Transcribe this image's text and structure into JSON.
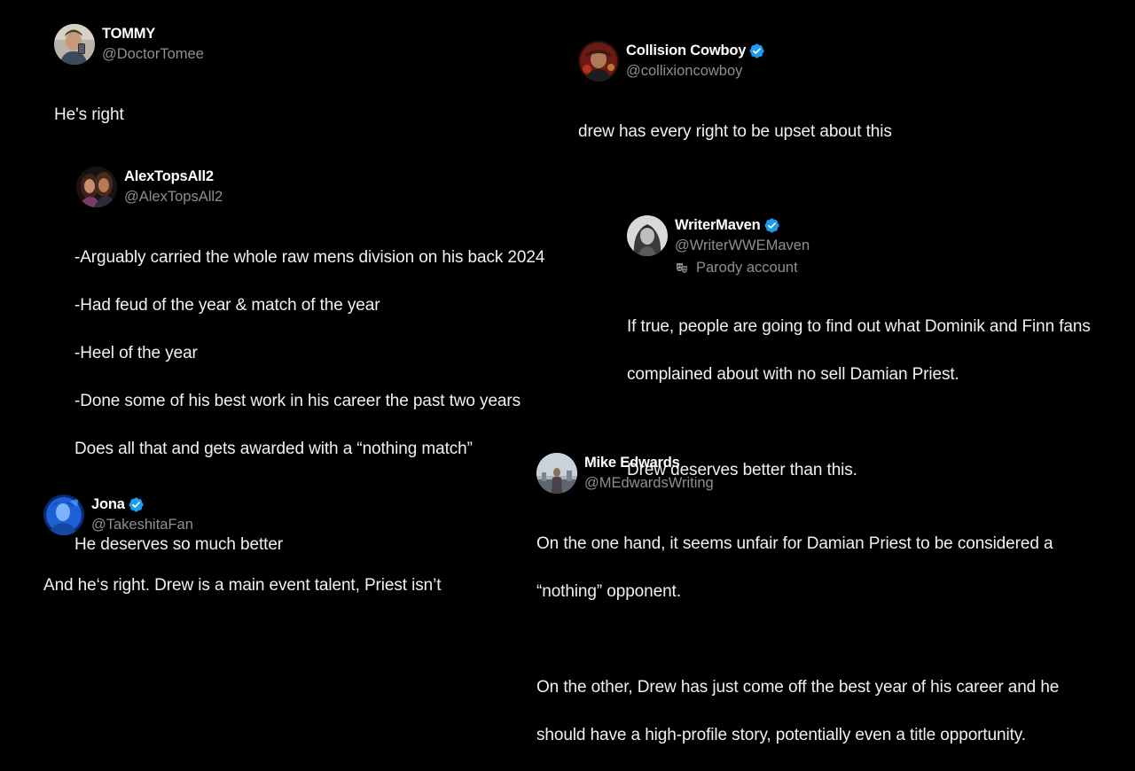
{
  "tweets": [
    {
      "id": "tommy",
      "display_name": "TOMMY",
      "handle": "@DoctorTomee",
      "verified": false,
      "lines": [
        "He's right"
      ]
    },
    {
      "id": "collision",
      "display_name": "Collision Cowboy",
      "handle": "@collixioncowboy",
      "verified": true,
      "lines": [
        "drew has every right to be upset about this"
      ]
    },
    {
      "id": "alex",
      "display_name": "AlexTopsAll2",
      "handle": "@AlexTopsAll2",
      "verified": false,
      "lines": [
        "-Arguably carried the whole raw mens division on his back 2024",
        "-Had feud of the year & match of the year",
        "-Heel of the year",
        "-Done some of his best work in his career the past two years",
        "Does all that and gets awarded with a “nothing match”",
        "",
        "He deserves so much better"
      ]
    },
    {
      "id": "writer",
      "display_name": "WriterMaven",
      "handle": "@WriterWWEMaven",
      "verified": true,
      "parody_label": "Parody account",
      "lines": [
        "If true, people are going to find out what Dominik and Finn fans",
        "complained about with no sell Damian Priest.",
        "",
        "Drew deserves better than this."
      ]
    },
    {
      "id": "jona",
      "display_name": "Jona",
      "handle": "@TakeshitaFan",
      "verified": true,
      "lines": [
        "And he‘s right. Drew is a main event talent, Priest isn’t"
      ]
    },
    {
      "id": "mike",
      "display_name": "Mike Edwards",
      "handle": "@MEdwardsWriting",
      "verified": false,
      "lines": [
        "On the one hand, it seems unfair for Damian Priest to be considered a",
        "“nothing” opponent.",
        "",
        "On the other, Drew has just come off the best year of his career and he",
        "should have a high-profile story, potentially even a title opportunity."
      ]
    }
  ],
  "colors": {
    "background": "#000000",
    "text": "#e7e9ea",
    "handle": "#8b8f94",
    "verified": "#1d9bf0"
  },
  "icons": {
    "verified": "verified-badge-icon",
    "parody": "theater-masks-icon"
  }
}
